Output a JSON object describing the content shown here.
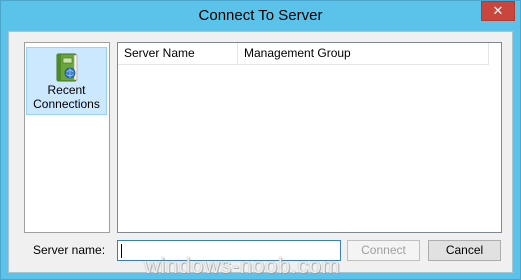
{
  "window": {
    "title": "Connect To Server",
    "close_glyph": "✕"
  },
  "sidebar": {
    "items": [
      {
        "label": "Recent Connections",
        "icon": "book-icon",
        "selected": true
      }
    ]
  },
  "list": {
    "columns": [
      "Server Name",
      "Management Group"
    ],
    "rows": []
  },
  "form": {
    "server_label": "Server name:",
    "server_value": ""
  },
  "buttons": {
    "connect_label": "Connect",
    "connect_enabled": false,
    "cancel_label": "Cancel"
  },
  "watermark": "windows-noob.com",
  "colors": {
    "titlebar": "#5bc2ea",
    "close_button": "#c9463d",
    "selection": "#cce8ff"
  }
}
